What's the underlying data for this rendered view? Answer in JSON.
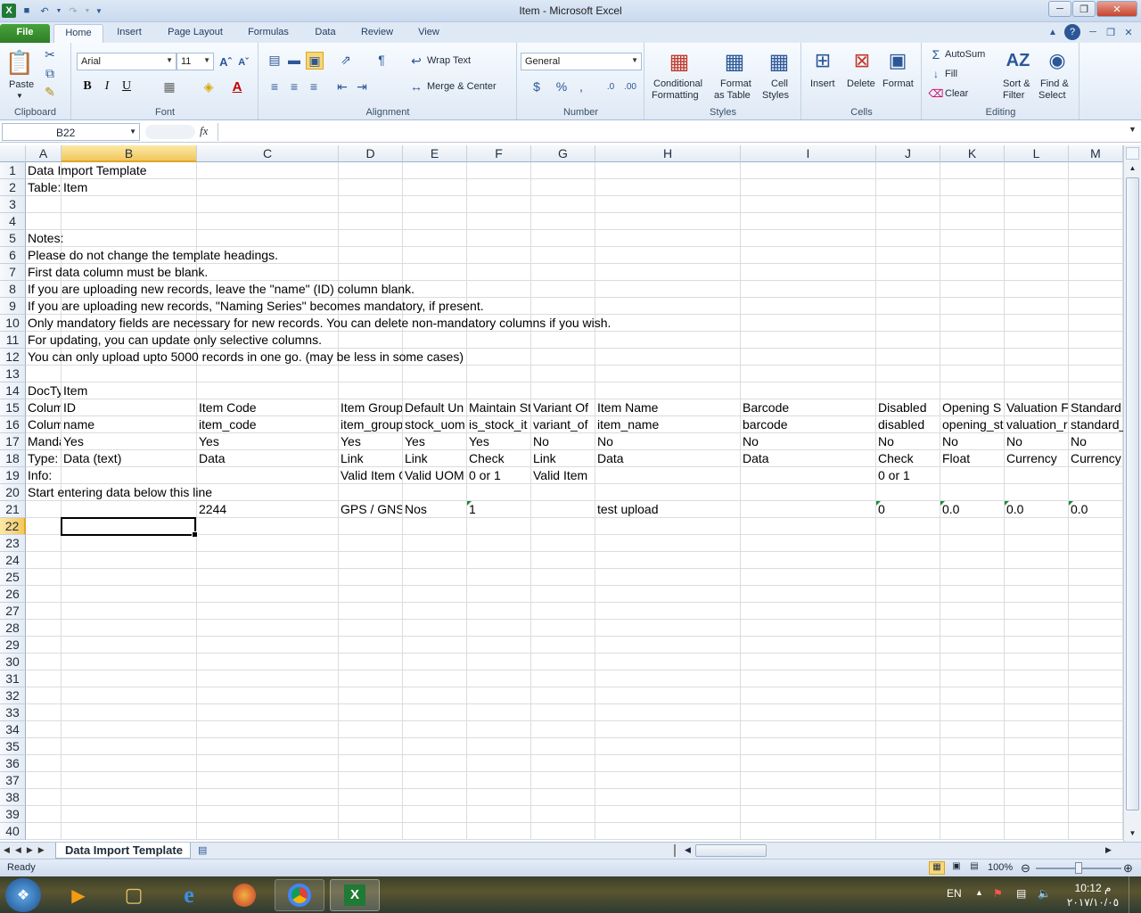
{
  "window": {
    "title": "Item  -  Microsoft Excel"
  },
  "ribbon": {
    "tabs": [
      "File",
      "Home",
      "Insert",
      "Page Layout",
      "Formulas",
      "Data",
      "Review",
      "View"
    ],
    "clipboard": {
      "paste": "Paste",
      "label": "Clipboard"
    },
    "font": {
      "name": "Arial",
      "size": "11",
      "bold": "B",
      "italic": "I",
      "underline": "U",
      "label": "Font"
    },
    "alignment": {
      "wrap_text": "Wrap Text",
      "merge_center": "Merge & Center",
      "label": "Alignment"
    },
    "number": {
      "format": "General",
      "label": "Number"
    },
    "styles": {
      "conditional": "Conditional",
      "conditional2": "Formatting",
      "format_table": "Format",
      "format_table2": "as Table",
      "cell_styles": "Cell",
      "cell_styles2": "Styles",
      "label": "Styles"
    },
    "cells": {
      "insert": "Insert",
      "delete": "Delete",
      "format": "Format",
      "label": "Cells"
    },
    "editing": {
      "autosum": "AutoSum",
      "fill": "Fill",
      "clear": "Clear",
      "sort": "Sort &",
      "sort2": "Filter",
      "find": "Find &",
      "find2": "Select",
      "label": "Editing"
    }
  },
  "formula_bar": {
    "name_box": "B22",
    "fx": "fx",
    "content": ""
  },
  "columns": [
    "A",
    "B",
    "C",
    "D",
    "E",
    "F",
    "G",
    "H",
    "I",
    "J",
    "K",
    "L",
    "M"
  ],
  "rows": [
    "1",
    "2",
    "3",
    "4",
    "5",
    "6",
    "7",
    "8",
    "9",
    "10",
    "11",
    "12",
    "13",
    "14",
    "15",
    "16",
    "17",
    "18",
    "19",
    "20",
    "21",
    "22",
    "23",
    "24",
    "25",
    "26",
    "27",
    "28",
    "29",
    "30",
    "31",
    "32",
    "33",
    "34",
    "35",
    "36",
    "37",
    "38",
    "39",
    "40"
  ],
  "cells": {
    "r1": {
      "A": "Data Import Template"
    },
    "r2": {
      "A": "Table:",
      "B": "Item"
    },
    "r5": {
      "A": "Notes:"
    },
    "r6": {
      "A": "Please do not change the template headings."
    },
    "r7": {
      "A": "First data column must be blank."
    },
    "r8": {
      "A": "If you are uploading new records, leave the \"name\" (ID) column blank."
    },
    "r9": {
      "A": "If you are uploading new records, \"Naming Series\" becomes mandatory, if present."
    },
    "r10": {
      "A": "Only mandatory fields are necessary for new records. You can delete non-mandatory columns if you wish."
    },
    "r11": {
      "A": "For updating, you can update only selective columns."
    },
    "r12": {
      "A": "You can only upload upto 5000 records in one go. (may be less in some cases)"
    },
    "r14": {
      "A": "DocTy",
      "B": "Item"
    },
    "r15": {
      "A": "Colum",
      "B": "ID",
      "C": "Item Code",
      "D": "Item Group",
      "E": "Default Un",
      "F": "Maintain St",
      "G": "Variant Of",
      "H": "Item Name",
      "I": "Barcode",
      "J": "Disabled",
      "K": "Opening S",
      "L": "Valuation F",
      "M": "Standard"
    },
    "r16": {
      "A": "Colum",
      "B": "name",
      "C": "item_code",
      "D": "item_group",
      "E": "stock_uom",
      "F": "is_stock_it",
      "G": "variant_of",
      "H": "item_name",
      "I": "barcode",
      "J": "disabled",
      "K": "opening_st",
      "L": "valuation_r",
      "M": "standard_"
    },
    "r17": {
      "A": "Manda",
      "B": "Yes",
      "C": "Yes",
      "D": "Yes",
      "E": "Yes",
      "F": "Yes",
      "G": "No",
      "H": "No",
      "I": "No",
      "J": "No",
      "K": "No",
      "L": "No",
      "M": "No"
    },
    "r18": {
      "A": "Type:",
      "B": "Data (text)",
      "C": "Data",
      "D": "Link",
      "E": "Link",
      "F": "Check",
      "G": "Link",
      "H": "Data",
      "I": "Data",
      "J": "Check",
      "K": "Float",
      "L": "Currency",
      "M": "Currency"
    },
    "r19": {
      "A": "Info:",
      "D": "Valid Item G",
      "E": "Valid UOM",
      "F": "0 or 1",
      "G": "Valid Item",
      "J": "0 or 1"
    },
    "r20": {
      "A": "Start entering data below this line"
    },
    "r21": {
      "C": "2244",
      "D": "GPS / GNSS",
      "E": "Nos",
      "F": "1",
      "H": "test upload",
      "J": "0",
      "K": "0.0",
      "L": "0.0",
      "M": "0.0"
    }
  },
  "sheet_tabs": [
    "Data Import Template"
  ],
  "status": {
    "ready": "Ready",
    "zoom": "100%"
  },
  "taskbar": {
    "lang": "EN",
    "time": "10:12 م",
    "date": "٢٠١٧/١٠/٠٥"
  },
  "colors": {
    "accent": "#2b5797",
    "file_tab": "#2f7d26",
    "selected_header": "#f3c75d"
  }
}
